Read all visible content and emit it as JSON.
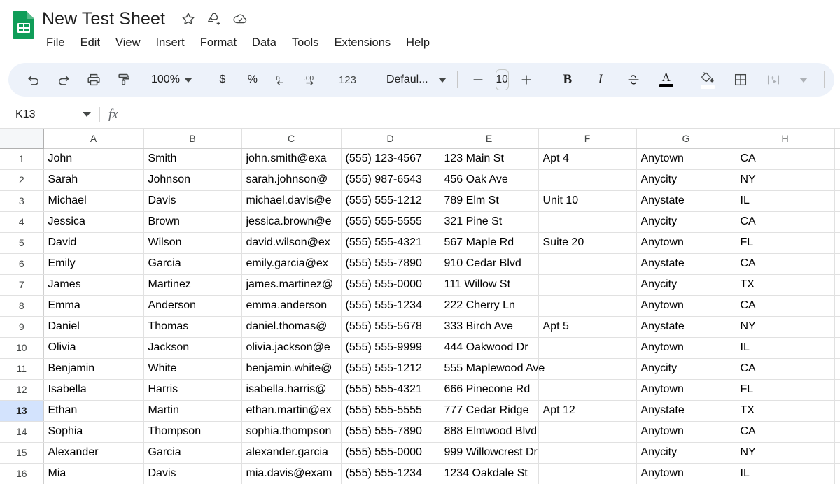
{
  "app": {
    "logo_icon": "sheets-logo-icon",
    "logo_color": "#0f9d58"
  },
  "header": {
    "doc_title": "New Test Sheet",
    "title_icons": [
      {
        "name": "star-icon",
        "tooltip": "Star"
      },
      {
        "name": "move-to-folder-icon",
        "tooltip": "Move"
      },
      {
        "name": "cloud-saved-icon",
        "tooltip": "Saved to Drive"
      }
    ],
    "menus": [
      "File",
      "Edit",
      "View",
      "Insert",
      "Format",
      "Data",
      "Tools",
      "Extensions",
      "Help"
    ]
  },
  "toolbar": {
    "undo_label": "undo-icon",
    "redo_label": "redo-icon",
    "print_label": "print-icon",
    "paint_format_label": "paint-format-icon",
    "zoom_value": "100%",
    "currency_label": "$",
    "percent_label": "%",
    "decrease_decimal_label": ".0",
    "increase_decimal_label": ".00",
    "more_formats_label": "123",
    "font_name": "Defaul...",
    "font_size_decrease": "−",
    "font_size_value": "10",
    "font_size_increase": "+",
    "bold_label": "B",
    "italic_label": "I",
    "strikethrough_label": "strikethrough-icon",
    "text_color_label": "A",
    "fill_color_label": "fill-color-icon",
    "borders_label": "borders-icon",
    "merge_cells_label": "merge-cells-icon",
    "horizontal_align_label": "horizontal-align-icon"
  },
  "formula_bar": {
    "name_box_value": "K13",
    "fx_label": "fx",
    "formula_value": ""
  },
  "grid": {
    "columns": [
      "A",
      "B",
      "C",
      "D",
      "E",
      "F",
      "G",
      "H"
    ],
    "selected_cell": "K13",
    "selected_row": 13,
    "row_numbers": [
      1,
      2,
      3,
      4,
      5,
      6,
      7,
      8,
      9,
      10,
      11,
      12,
      13,
      14,
      15,
      16
    ],
    "rows": [
      [
        "John",
        "Smith",
        "john.smith@exa",
        "(555) 123-4567",
        "123 Main St",
        "Apt 4",
        "Anytown",
        "CA"
      ],
      [
        "Sarah",
        "Johnson",
        "sarah.johnson@",
        "(555) 987-6543",
        "456 Oak Ave",
        "",
        "Anycity",
        "NY"
      ],
      [
        "Michael",
        "Davis",
        "michael.davis@e",
        "(555) 555-1212",
        "789 Elm St",
        "Unit 10",
        "Anystate",
        "IL"
      ],
      [
        "Jessica",
        "Brown",
        "jessica.brown@e",
        "(555) 555-5555",
        "321 Pine St",
        "",
        "Anycity",
        "CA"
      ],
      [
        "David",
        "Wilson",
        "david.wilson@ex",
        "(555) 555-4321",
        "567 Maple Rd",
        "Suite 20",
        "Anytown",
        "FL"
      ],
      [
        "Emily",
        "Garcia",
        "emily.garcia@ex",
        "(555) 555-7890",
        "910 Cedar Blvd",
        "",
        "Anystate",
        "CA"
      ],
      [
        "James",
        "Martinez",
        "james.martinez@",
        "(555) 555-0000",
        "111 Willow St",
        "",
        "Anycity",
        "TX"
      ],
      [
        "Emma",
        "Anderson",
        "emma.anderson",
        "(555) 555-1234",
        "222 Cherry Ln",
        "",
        "Anytown",
        "CA"
      ],
      [
        "Daniel",
        "Thomas",
        "daniel.thomas@",
        "(555) 555-5678",
        "333 Birch Ave",
        "Apt 5",
        "Anystate",
        "NY"
      ],
      [
        "Olivia",
        "Jackson",
        "olivia.jackson@e",
        "(555) 555-9999",
        "444 Oakwood Dr",
        "",
        "Anytown",
        "IL"
      ],
      [
        "Benjamin",
        "White",
        "benjamin.white@",
        "(555) 555-1212",
        "555 Maplewood Ave",
        "",
        "Anycity",
        "CA"
      ],
      [
        "Isabella",
        "Harris",
        "isabella.harris@",
        "(555) 555-4321",
        "666 Pinecone Rd",
        "",
        "Anytown",
        "FL"
      ],
      [
        "Ethan",
        "Martin",
        "ethan.martin@ex",
        "(555) 555-5555",
        "777 Cedar Ridge",
        "Apt 12",
        "Anystate",
        "TX"
      ],
      [
        "Sophia",
        "Thompson",
        "sophia.thompson",
        "(555) 555-7890",
        "888 Elmwood Blvd",
        "",
        "Anytown",
        "CA"
      ],
      [
        "Alexander",
        "Garcia",
        "alexander.garcia",
        "(555) 555-0000",
        "999 Willowcrest Dr",
        "",
        "Anycity",
        "NY"
      ],
      [
        "Mia",
        "Davis",
        "mia.davis@exam",
        "(555) 555-1234",
        "1234 Oakdale St",
        "",
        "Anytown",
        "IL"
      ]
    ]
  },
  "colors": {
    "sheets_green": "#0f9d58",
    "toolbar_bg": "#edf2fa",
    "selection_blue": "#d3e3fd",
    "grid_line": "#e1e1e1",
    "text_primary": "#1f1f1f",
    "text_secondary": "#444746"
  }
}
